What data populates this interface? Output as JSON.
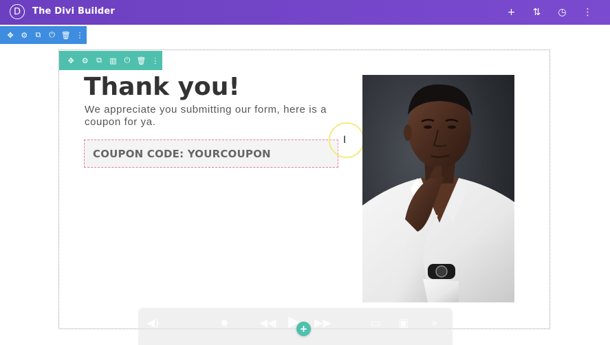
{
  "app": {
    "logo_letter": "D",
    "title": "The Divi Builder"
  },
  "topbar": {
    "add_icon": "+",
    "sort_icon": "⇅",
    "history_icon": "◷",
    "more_icon": "⋮"
  },
  "section_toolbar": {
    "icons": [
      "move-icon",
      "gear-icon",
      "duplicate-icon",
      "power-icon",
      "trash-icon",
      "more-icon"
    ],
    "glyphs": [
      "✥",
      "⚙",
      "⧉",
      "⏻",
      "🗑",
      "⋮"
    ]
  },
  "row_toolbar": {
    "icons": [
      "move-icon",
      "gear-icon",
      "duplicate-icon",
      "columns-icon",
      "power-icon",
      "trash-icon",
      "more-icon"
    ],
    "glyphs": [
      "✥",
      "⚙",
      "⧉",
      "▥",
      "⏻",
      "🗑",
      "⋮"
    ]
  },
  "content": {
    "heading": "Thank you!",
    "subtext": "We appreciate you submitting our form, here is a coupon for ya.",
    "coupon": "COUPON CODE: YOURCOUPON"
  },
  "cursor": {
    "glyph": "I"
  },
  "add_module": {
    "label": "+"
  },
  "colors": {
    "topbar": "#7245c8",
    "section_toolbar": "#3e8de0",
    "row_toolbar": "#4fc0ae",
    "coupon_border": "#e37f98"
  }
}
